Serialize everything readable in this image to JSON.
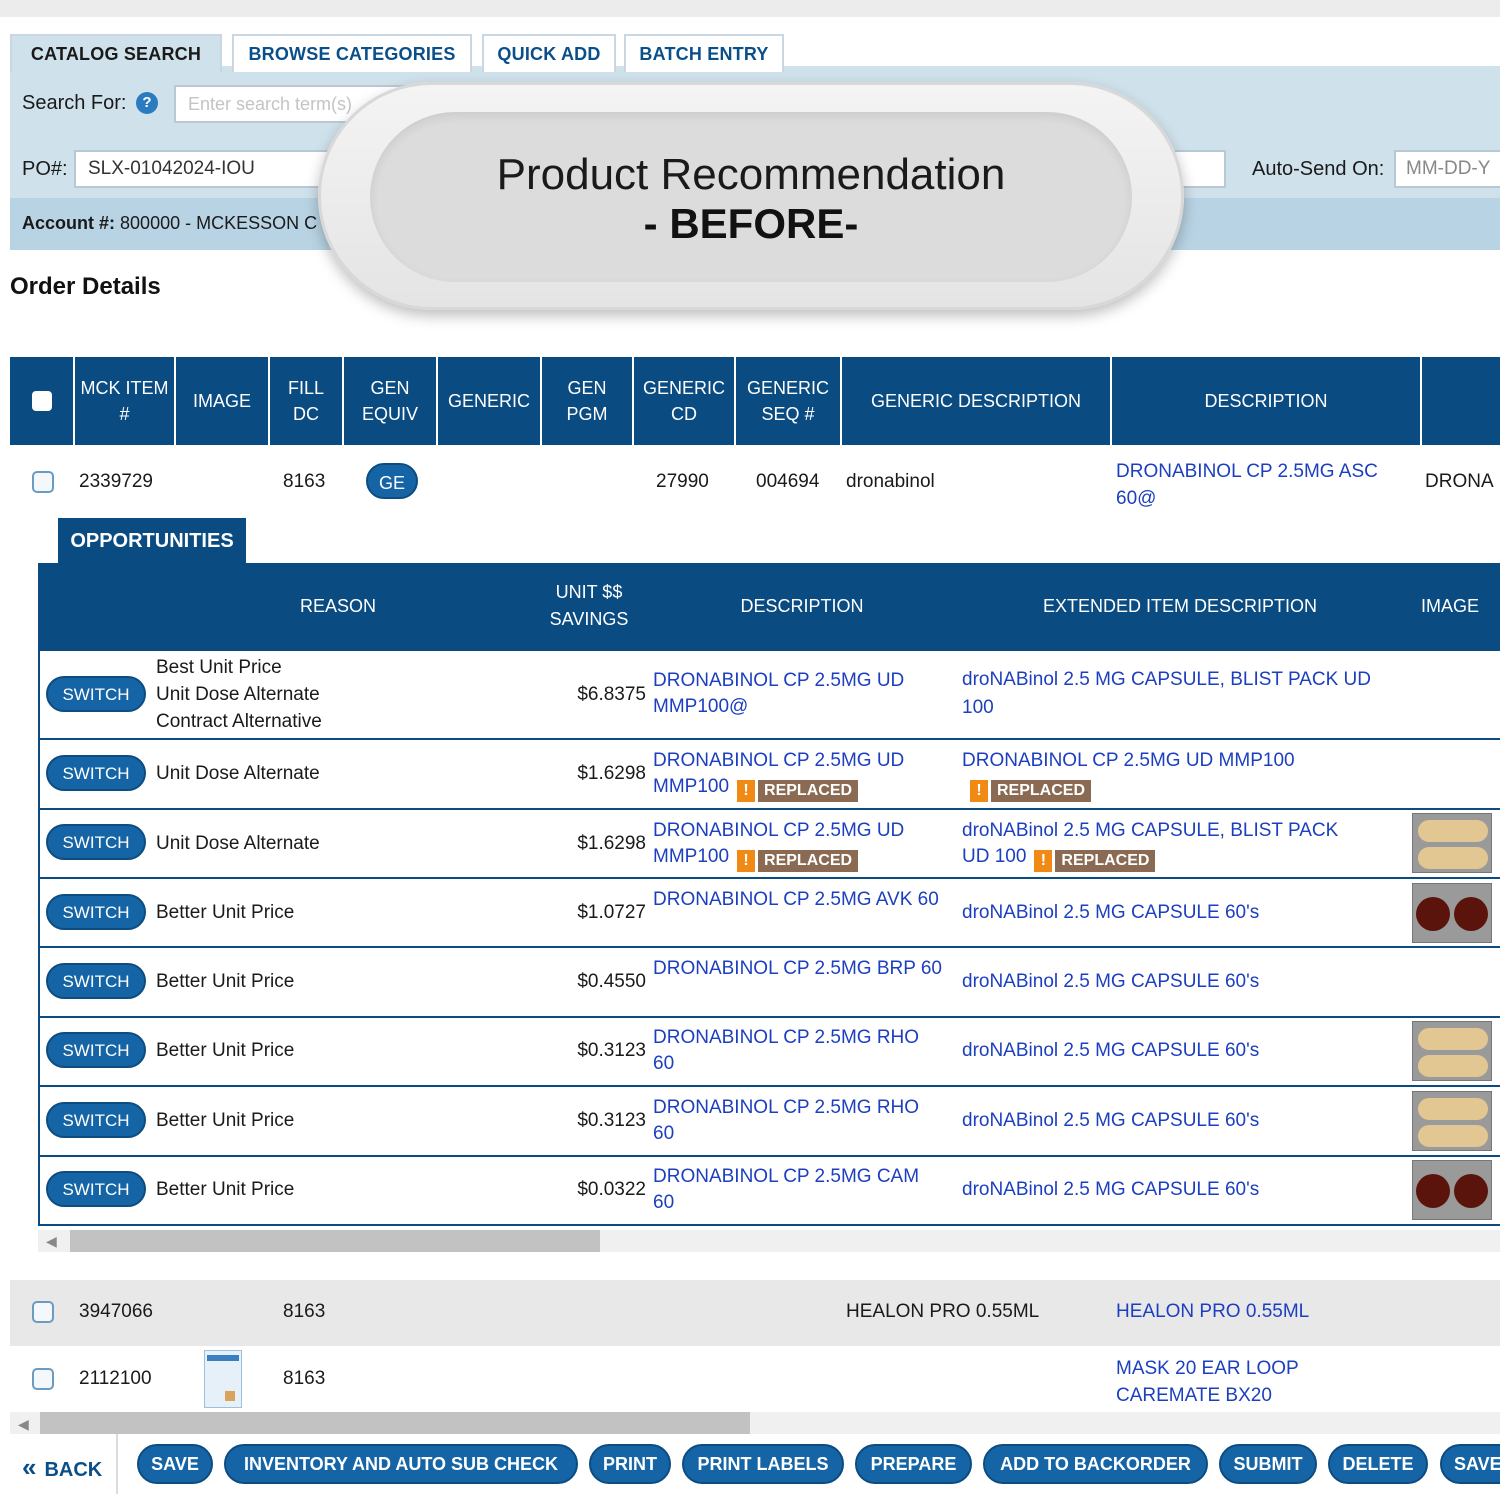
{
  "tabs": [
    "CATALOG SEARCH",
    "BROWSE CATEGORIES",
    "QUICK ADD",
    "BATCH ENTRY"
  ],
  "search": {
    "label": "Search For:",
    "placeholder": "Enter search term(s)",
    "help_icon": "?"
  },
  "po": {
    "label": "PO#:",
    "value": "SLX-01042024-IOU"
  },
  "auto_send": {
    "label": "Auto-Send On:",
    "value": "MM-DD-Y"
  },
  "account": {
    "label": "Account #:",
    "value": "800000 - MCKESSON C"
  },
  "order_title": "Order Details",
  "overlay": {
    "title": "Product Recommendation",
    "subtitle": "- BEFORE-"
  },
  "grid_headers": [
    "MCK ITEM #",
    "IMAGE",
    "FILL DC",
    "GEN EQUIV",
    "GENERIC",
    "GEN PGM",
    "GENERIC CD",
    "GENERIC SEQ #",
    "GENERIC DESCRIPTION",
    "DESCRIPTION"
  ],
  "rows": [
    {
      "item": "2339729",
      "fill_dc": "8163",
      "gen_equiv": "GE",
      "generic_cd": "27990",
      "generic_seq": "004694",
      "generic_desc": "dronabinol",
      "description": "DRONABINOL CP 2.5MG ASC 60@",
      "extra": "DRONA"
    },
    {
      "item": "3947066",
      "fill_dc": "8163",
      "generic_desc": "HEALON PRO 0.55ML",
      "description": "HEALON PRO 0.55ML"
    },
    {
      "item": "2112100",
      "fill_dc": "8163",
      "description": "MASK 20 EAR LOOP CAREMATE BX20"
    }
  ],
  "opportunities": {
    "tab_label": "OPPORTUNITIES",
    "headers": {
      "reason": "REASON",
      "savings": "UNIT $$ SAVINGS",
      "description": "DESCRIPTION",
      "extended": "EXTENDED ITEM DESCRIPTION",
      "image": "IMAGE"
    },
    "switch_label": "SWITCH",
    "replaced_label": "REPLACED",
    "warn_icon": "!",
    "items": [
      {
        "reason": [
          "Best Unit Price",
          "Unit Dose Alternate",
          "Contract Alternative"
        ],
        "savings": "$6.8375",
        "desc": "DRONABINOL CP 2.5MG UD MMP100@",
        "ext": "droNABinol 2.5 MG CAPSULE, BLIST PACK UD 100"
      },
      {
        "reason": [
          "Unit Dose Alternate"
        ],
        "savings": "$1.6298",
        "desc_line1": "DRONABINOL CP 2.5MG UD",
        "desc_line2": "MMP100",
        "ext": "DRONABINOL CP 2.5MG UD MMP100"
      },
      {
        "reason": [
          "Unit Dose Alternate"
        ],
        "savings": "$1.6298",
        "desc_line1": "DRONABINOL CP 2.5MG UD",
        "desc_line2": "MMP100",
        "ext_line1": "droNABinol 2.5 MG CAPSULE, BLIST PACK",
        "ext_line2": "UD 100"
      },
      {
        "reason": [
          "Better Unit Price"
        ],
        "savings": "$1.0727",
        "desc": "DRONABINOL CP 2.5MG AVK 60",
        "ext": "droNABinol 2.5 MG CAPSULE 60's"
      },
      {
        "reason": [
          "Better Unit Price"
        ],
        "savings": "$0.4550",
        "desc": "DRONABINOL CP 2.5MG BRP 60",
        "ext": "droNABinol 2.5 MG CAPSULE 60's"
      },
      {
        "reason": [
          "Better Unit Price"
        ],
        "savings": "$0.3123",
        "desc": "DRONABINOL CP 2.5MG RHO 60",
        "ext": "droNABinol 2.5 MG CAPSULE 60's"
      },
      {
        "reason": [
          "Better Unit Price"
        ],
        "savings": "$0.3123",
        "desc": "DRONABINOL CP 2.5MG RHO 60",
        "ext": "droNABinol 2.5 MG CAPSULE 60's"
      },
      {
        "reason": [
          "Better Unit Price"
        ],
        "savings": "$0.0322",
        "desc": "DRONABINOL CP 2.5MG CAM 60",
        "ext": "droNABinol 2.5 MG CAPSULE 60's"
      }
    ]
  },
  "footer": {
    "back": "BACK",
    "back_icon": "«",
    "buttons": [
      "SAVE",
      "INVENTORY AND AUTO SUB CHECK",
      "PRINT",
      "PRINT LABELS",
      "PREPARE",
      "ADD TO BACKORDER",
      "SUBMIT",
      "DELETE",
      "SAVE"
    ]
  },
  "colors": {
    "header_blue": "#0a4b82",
    "button_blue": "#1565a6",
    "link_blue": "#1c3fbf",
    "panel_blue": "#cfe1eb",
    "replaced_brown": "#8a6a52",
    "warn_orange": "#f08a15"
  }
}
